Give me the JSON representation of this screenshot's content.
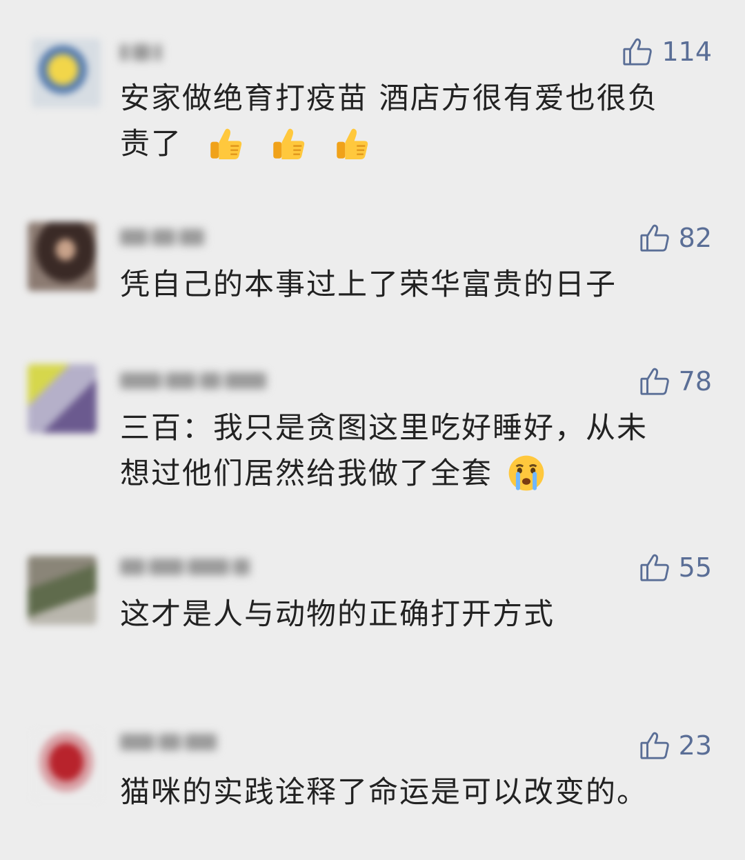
{
  "comments": [
    {
      "likes": "114",
      "line1": "安家做绝育打疫苗 酒店方很有爱也很负",
      "line2": "责了",
      "emojis": [
        "thumbs-up-emoji",
        "thumbs-up-emoji",
        "thumbs-up-emoji"
      ]
    },
    {
      "likes": "82",
      "line1": "凭自己的本事过上了荣华富贵的日子"
    },
    {
      "likes": "78",
      "line1": "三百：我只是贪图这里吃好睡好，从未",
      "line2": "想过他们居然给我做了全套",
      "emojis": [
        "crying-face-emoji"
      ]
    },
    {
      "likes": "55",
      "line1": "这才是人与动物的正确打开方式"
    },
    {
      "likes": "23",
      "line1": "猫咪的实践诠释了命运是可以改变的。"
    }
  ],
  "colors": {
    "background": "#ededed",
    "like_color": "#5a6e96",
    "text_color": "#222222"
  }
}
